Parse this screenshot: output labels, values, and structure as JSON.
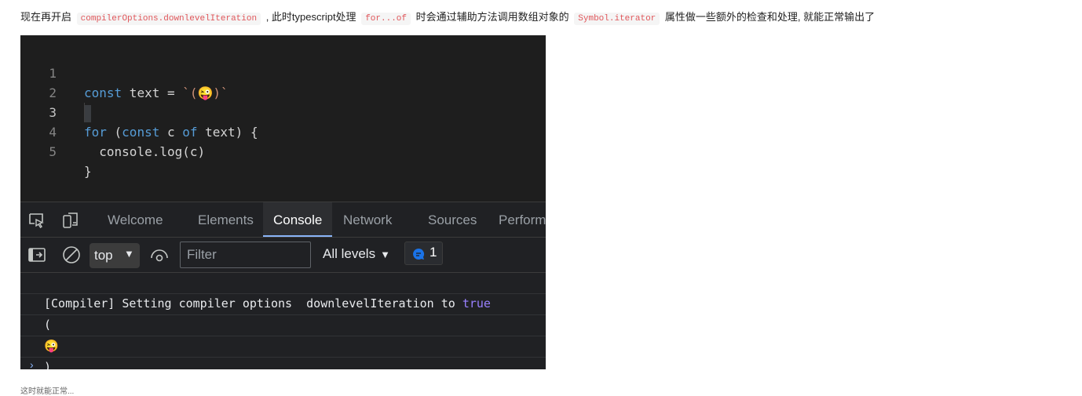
{
  "paragraph": {
    "text_1": "现在再开启",
    "code_1": "compilerOptions.downlevelIteration",
    "text_2": ", 此时typescript处理",
    "code_2": "for...of",
    "text_3": "时会通过辅助方法调用数组对象的",
    "code_3": "Symbol.iterator",
    "text_4": "属性做一些额外的检查和处理, 就能正常输出了"
  },
  "editor": {
    "lines": [
      {
        "num": "1",
        "kw1": "const",
        "t1": " text = ",
        "str": "`(😜)`"
      },
      {
        "num": "2"
      },
      {
        "num": "3",
        "kw1": "for",
        "t1": " (",
        "kw2": "const",
        "t2": " c ",
        "kw3": "of",
        "t3": " text) {"
      },
      {
        "num": "4",
        "t1": "  console.log(c)"
      },
      {
        "num": "5",
        "t1": "}"
      }
    ]
  },
  "devtools": {
    "tabs": [
      "Welcome",
      "Elements",
      "Console",
      "Network",
      "Sources",
      "Perform"
    ],
    "active_tab": "Console",
    "context": "top",
    "filter_placeholder": "Filter",
    "levels": "All levels",
    "issues_count": "1",
    "console_lines": [
      {
        "prefix": "[Compiler] Setting compiler options  downlevelIteration to ",
        "bool": "true"
      },
      {
        "prefix": "("
      },
      {
        "prefix": "😜"
      },
      {
        "prefix": ")"
      }
    ],
    "prompt": "›"
  },
  "trailing_text": "这时就能正常..."
}
